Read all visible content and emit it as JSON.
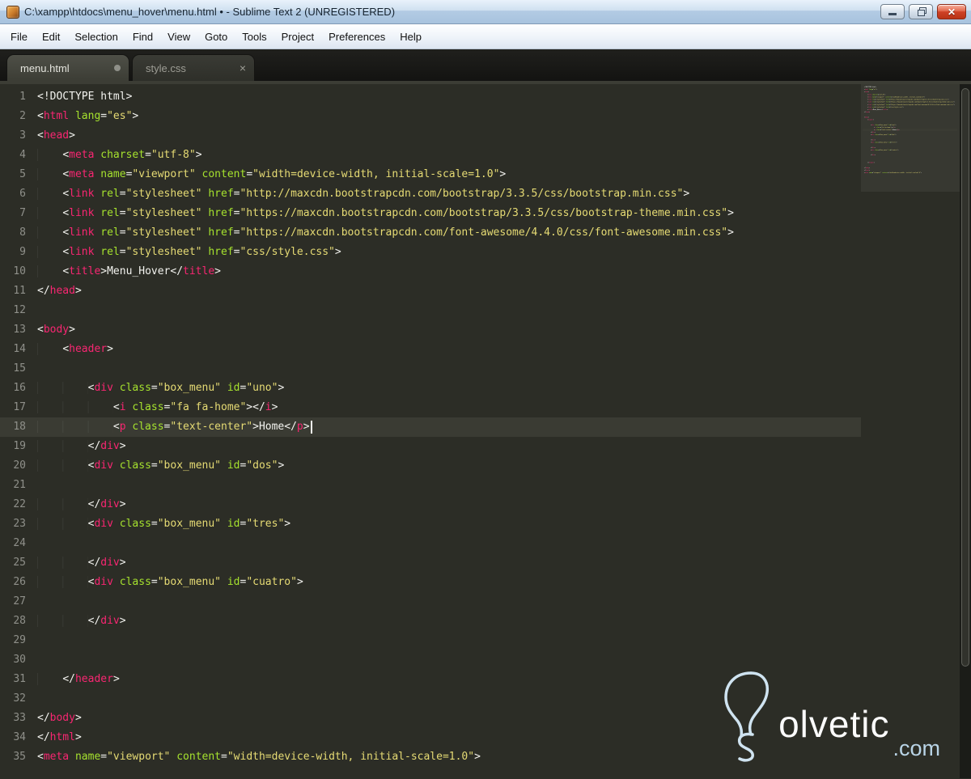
{
  "window": {
    "title": "C:\\xampp\\htdocs\\menu_hover\\menu.html • - Sublime Text 2 (UNREGISTERED)"
  },
  "icons": {
    "app_icon": "sublime-text-logo",
    "minimize": "minimize-dash",
    "restore": "restore-overlapping-windows",
    "close_glyph": "✕",
    "tab_close_glyph": "×",
    "modified_dot": "●"
  },
  "colors": {
    "editor_bg": "#2c2d26",
    "tag": "#f92672",
    "attribute": "#a6e22e",
    "string": "#e6db74",
    "plain": "#f3f3ef",
    "line_number": "#8f908a",
    "current_line_bg": "#3a3b33",
    "titlebar_blue": "#b3cbe4",
    "close_red": "#cf4227",
    "watermark_blue": "#b9d4e6"
  },
  "menu_bar": {
    "items": [
      "File",
      "Edit",
      "Selection",
      "Find",
      "View",
      "Goto",
      "Tools",
      "Project",
      "Preferences",
      "Help"
    ]
  },
  "tabs": [
    {
      "label": "menu.html",
      "active": true,
      "modified": true,
      "closable": false
    },
    {
      "label": "style.css",
      "active": false,
      "modified": false,
      "closable": true
    }
  ],
  "editor": {
    "current_line": 18,
    "cursor_line": 18,
    "lines": [
      {
        "n": 1,
        "s": [
          [
            "w",
            "<!DOCTYPE html>"
          ]
        ]
      },
      {
        "n": 2,
        "s": [
          [
            "w",
            "<"
          ],
          [
            "t",
            "html"
          ],
          [
            "w",
            " "
          ],
          [
            "a",
            "lang"
          ],
          [
            "w",
            "="
          ],
          [
            "s",
            "\"es\""
          ],
          [
            "w",
            ">"
          ]
        ]
      },
      {
        "n": 3,
        "s": [
          [
            "w",
            "<"
          ],
          [
            "t",
            "head"
          ],
          [
            "w",
            ">"
          ]
        ]
      },
      {
        "n": 4,
        "s": [
          [
            "w",
            "    <"
          ],
          [
            "t",
            "meta"
          ],
          [
            "w",
            " "
          ],
          [
            "a",
            "charset"
          ],
          [
            "w",
            "="
          ],
          [
            "s",
            "\"utf-8\""
          ],
          [
            "w",
            ">"
          ]
        ]
      },
      {
        "n": 5,
        "s": [
          [
            "w",
            "    <"
          ],
          [
            "t",
            "meta"
          ],
          [
            "w",
            " "
          ],
          [
            "a",
            "name"
          ],
          [
            "w",
            "="
          ],
          [
            "s",
            "\"viewport\""
          ],
          [
            "w",
            " "
          ],
          [
            "a",
            "content"
          ],
          [
            "w",
            "="
          ],
          [
            "s",
            "\"width=device-width, initial-scale=1.0\""
          ],
          [
            "w",
            ">"
          ]
        ]
      },
      {
        "n": 6,
        "s": [
          [
            "w",
            "    <"
          ],
          [
            "t",
            "link"
          ],
          [
            "w",
            " "
          ],
          [
            "a",
            "rel"
          ],
          [
            "w",
            "="
          ],
          [
            "s",
            "\"stylesheet\""
          ],
          [
            "w",
            " "
          ],
          [
            "a",
            "href"
          ],
          [
            "w",
            "="
          ],
          [
            "s",
            "\"http://maxcdn.bootstrapcdn.com/bootstrap/3.3.5/css/bootstrap.min.css\""
          ],
          [
            "w",
            ">"
          ]
        ]
      },
      {
        "n": 7,
        "s": [
          [
            "w",
            "    <"
          ],
          [
            "t",
            "link"
          ],
          [
            "w",
            " "
          ],
          [
            "a",
            "rel"
          ],
          [
            "w",
            "="
          ],
          [
            "s",
            "\"stylesheet\""
          ],
          [
            "w",
            " "
          ],
          [
            "a",
            "href"
          ],
          [
            "w",
            "="
          ],
          [
            "s",
            "\"https://maxcdn.bootstrapcdn.com/bootstrap/3.3.5/css/bootstrap-theme.min.css\""
          ],
          [
            "w",
            ">"
          ]
        ]
      },
      {
        "n": 8,
        "s": [
          [
            "w",
            "    <"
          ],
          [
            "t",
            "link"
          ],
          [
            "w",
            " "
          ],
          [
            "a",
            "rel"
          ],
          [
            "w",
            "="
          ],
          [
            "s",
            "\"stylesheet\""
          ],
          [
            "w",
            " "
          ],
          [
            "a",
            "href"
          ],
          [
            "w",
            "="
          ],
          [
            "s",
            "\"https://maxcdn.bootstrapcdn.com/font-awesome/4.4.0/css/font-awesome.min.css\""
          ],
          [
            "w",
            ">"
          ]
        ]
      },
      {
        "n": 9,
        "s": [
          [
            "w",
            "    <"
          ],
          [
            "t",
            "link"
          ],
          [
            "w",
            " "
          ],
          [
            "a",
            "rel"
          ],
          [
            "w",
            "="
          ],
          [
            "s",
            "\"stylesheet\""
          ],
          [
            "w",
            " "
          ],
          [
            "a",
            "href"
          ],
          [
            "w",
            "="
          ],
          [
            "s",
            "\"css/style.css\""
          ],
          [
            "w",
            ">"
          ]
        ]
      },
      {
        "n": 10,
        "s": [
          [
            "w",
            "    <"
          ],
          [
            "t",
            "title"
          ],
          [
            "w",
            ">Menu_Hover</"
          ],
          [
            "t",
            "title"
          ],
          [
            "w",
            ">"
          ]
        ]
      },
      {
        "n": 11,
        "s": [
          [
            "w",
            "</"
          ],
          [
            "t",
            "head"
          ],
          [
            "w",
            ">"
          ]
        ]
      },
      {
        "n": 12,
        "s": []
      },
      {
        "n": 13,
        "s": [
          [
            "w",
            "<"
          ],
          [
            "t",
            "body"
          ],
          [
            "w",
            ">"
          ]
        ]
      },
      {
        "n": 14,
        "s": [
          [
            "w",
            "    <"
          ],
          [
            "t",
            "header"
          ],
          [
            "w",
            ">"
          ]
        ]
      },
      {
        "n": 15,
        "s": []
      },
      {
        "n": 16,
        "s": [
          [
            "w",
            "        <"
          ],
          [
            "t",
            "div"
          ],
          [
            "w",
            " "
          ],
          [
            "a",
            "class"
          ],
          [
            "w",
            "="
          ],
          [
            "s",
            "\"box_menu\""
          ],
          [
            "w",
            " "
          ],
          [
            "a",
            "id"
          ],
          [
            "w",
            "="
          ],
          [
            "s",
            "\"uno\""
          ],
          [
            "w",
            ">"
          ]
        ]
      },
      {
        "n": 17,
        "s": [
          [
            "w",
            "            <"
          ],
          [
            "t",
            "i"
          ],
          [
            "w",
            " "
          ],
          [
            "a",
            "class"
          ],
          [
            "w",
            "="
          ],
          [
            "s",
            "\"fa fa-home\""
          ],
          [
            "w",
            "></"
          ],
          [
            "t",
            "i"
          ],
          [
            "w",
            ">"
          ]
        ]
      },
      {
        "n": 18,
        "s": [
          [
            "w",
            "            <"
          ],
          [
            "t",
            "p"
          ],
          [
            "w",
            " "
          ],
          [
            "a",
            "class"
          ],
          [
            "w",
            "="
          ],
          [
            "s",
            "\"text-center\""
          ],
          [
            "w",
            ">Home</"
          ],
          [
            "t",
            "p"
          ],
          [
            "w",
            ">"
          ]
        ],
        "cursor": true
      },
      {
        "n": 19,
        "s": [
          [
            "w",
            "        </"
          ],
          [
            "t",
            "div"
          ],
          [
            "w",
            ">"
          ]
        ]
      },
      {
        "n": 20,
        "s": [
          [
            "w",
            "        <"
          ],
          [
            "t",
            "div"
          ],
          [
            "w",
            " "
          ],
          [
            "a",
            "class"
          ],
          [
            "w",
            "="
          ],
          [
            "s",
            "\"box_menu\""
          ],
          [
            "w",
            " "
          ],
          [
            "a",
            "id"
          ],
          [
            "w",
            "="
          ],
          [
            "s",
            "\"dos\""
          ],
          [
            "w",
            ">"
          ]
        ]
      },
      {
        "n": 21,
        "s": []
      },
      {
        "n": 22,
        "s": [
          [
            "w",
            "        </"
          ],
          [
            "t",
            "div"
          ],
          [
            "w",
            ">"
          ]
        ]
      },
      {
        "n": 23,
        "s": [
          [
            "w",
            "        <"
          ],
          [
            "t",
            "div"
          ],
          [
            "w",
            " "
          ],
          [
            "a",
            "class"
          ],
          [
            "w",
            "="
          ],
          [
            "s",
            "\"box_menu\""
          ],
          [
            "w",
            " "
          ],
          [
            "a",
            "id"
          ],
          [
            "w",
            "="
          ],
          [
            "s",
            "\"tres\""
          ],
          [
            "w",
            ">"
          ]
        ]
      },
      {
        "n": 24,
        "s": []
      },
      {
        "n": 25,
        "s": [
          [
            "w",
            "        </"
          ],
          [
            "t",
            "div"
          ],
          [
            "w",
            ">"
          ]
        ]
      },
      {
        "n": 26,
        "s": [
          [
            "w",
            "        <"
          ],
          [
            "t",
            "div"
          ],
          [
            "w",
            " "
          ],
          [
            "a",
            "class"
          ],
          [
            "w",
            "="
          ],
          [
            "s",
            "\"box_menu\""
          ],
          [
            "w",
            " "
          ],
          [
            "a",
            "id"
          ],
          [
            "w",
            "="
          ],
          [
            "s",
            "\"cuatro\""
          ],
          [
            "w",
            ">"
          ]
        ]
      },
      {
        "n": 27,
        "s": []
      },
      {
        "n": 28,
        "s": [
          [
            "w",
            "        </"
          ],
          [
            "t",
            "div"
          ],
          [
            "w",
            ">"
          ]
        ]
      },
      {
        "n": 29,
        "s": []
      },
      {
        "n": 30,
        "s": []
      },
      {
        "n": 31,
        "s": [
          [
            "w",
            "    </"
          ],
          [
            "t",
            "header"
          ],
          [
            "w",
            ">"
          ]
        ]
      },
      {
        "n": 32,
        "s": []
      },
      {
        "n": 33,
        "s": [
          [
            "w",
            "</"
          ],
          [
            "t",
            "body"
          ],
          [
            "w",
            ">"
          ]
        ]
      },
      {
        "n": 34,
        "s": [
          [
            "w",
            "</"
          ],
          [
            "t",
            "html"
          ],
          [
            "w",
            ">"
          ]
        ]
      },
      {
        "n": 35,
        "s": [
          [
            "w",
            "<"
          ],
          [
            "t",
            "meta"
          ],
          [
            "w",
            " "
          ],
          [
            "a",
            "name"
          ],
          [
            "w",
            "="
          ],
          [
            "s",
            "\"viewport\""
          ],
          [
            "w",
            " "
          ],
          [
            "a",
            "content"
          ],
          [
            "w",
            "="
          ],
          [
            "s",
            "\"width=device-width, initial-scale=1.0\""
          ],
          [
            "w",
            ">"
          ]
        ]
      }
    ]
  },
  "watermark": {
    "text": "olvetic",
    "suffix": ".com"
  }
}
